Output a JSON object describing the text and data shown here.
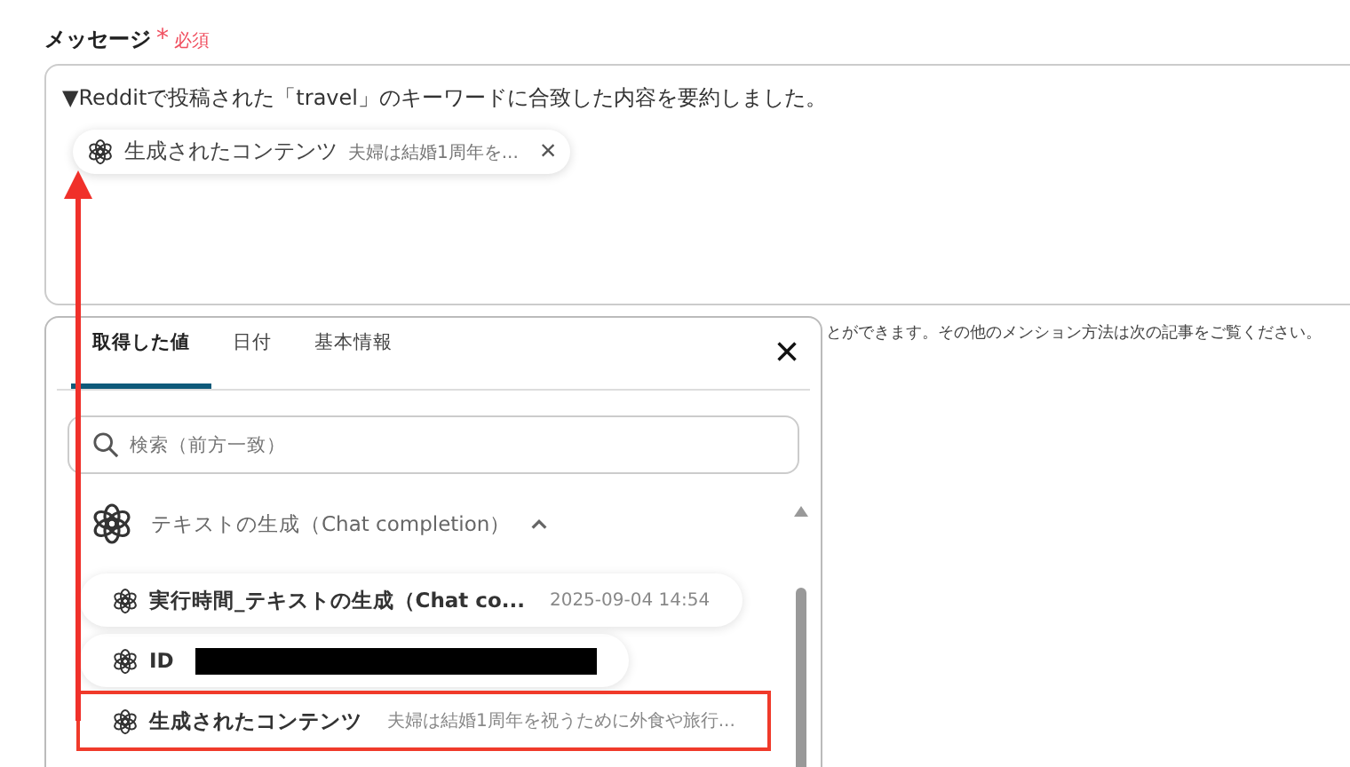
{
  "field": {
    "label": "メッセージ",
    "required_mark": "*",
    "required_text": "必須",
    "text": "▼Redditで投稿された「travel」のキーワードに合致した内容を要約しました。",
    "token": {
      "name": "生成されたコンテンツ",
      "preview": "夫婦は結婚1周年を...",
      "remove": "×"
    },
    "hint": "とができます。その他のメンション方法は次の記事をご覧ください。"
  },
  "panel": {
    "tabs": [
      {
        "label": "取得した値",
        "selected": true
      },
      {
        "label": "日付",
        "selected": false
      },
      {
        "label": "基本情報",
        "selected": false
      }
    ],
    "close": "×",
    "search": {
      "placeholder": "検索（前方一致）"
    },
    "group": {
      "title": "テキストの生成（Chat completion）",
      "expanded": true,
      "items": [
        {
          "kind": "value",
          "name": "実行時間_テキストの生成（Chat co...",
          "value": "2025-09-04 14:54",
          "highlighted": false
        },
        {
          "kind": "redacted",
          "name": "ID",
          "highlighted": false
        },
        {
          "kind": "value",
          "name": "生成されたコンテンツ",
          "value": "夫婦は結婚1周年を祝うために外食や旅行...",
          "highlighted": true
        }
      ]
    }
  }
}
